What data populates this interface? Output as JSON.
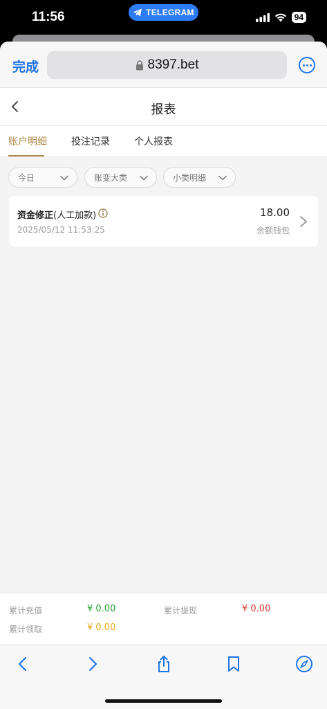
{
  "status_bar": {
    "time": "11:56",
    "telegram_pill": "TELEGRAM",
    "battery": "94"
  },
  "browser": {
    "done_label": "完成",
    "url": "8397.bet",
    "accent_color": "#1f74e8"
  },
  "page": {
    "title": "报表"
  },
  "tabs": [
    {
      "label": "账户明细",
      "active": true
    },
    {
      "label": "投注记录",
      "active": false
    },
    {
      "label": "个人报表",
      "active": false
    }
  ],
  "filters": [
    {
      "label": "今日"
    },
    {
      "label": "账变大类"
    },
    {
      "label": "小类明细"
    }
  ],
  "record": {
    "title": "资金修正",
    "subtitle": "(人工加款)",
    "time": "2025/05/12 11:53:25",
    "amount": "18.00",
    "wallet": "余额钱包"
  },
  "summary": {
    "recharge_label": "累计充值",
    "recharge_value": "¥ 0.00",
    "withdraw_label": "累计提现",
    "withdraw_value": "¥ 0.00",
    "claim_label": "累计领取",
    "claim_value": "¥ 0.00",
    "colors": {
      "recharge": "#22a32a",
      "withdraw": "#e0392b",
      "claim": "#e6a817"
    }
  },
  "toolbar": {
    "icons": [
      "back-icon",
      "forward-icon",
      "share-icon",
      "bookmarks-icon",
      "compass-icon"
    ]
  }
}
